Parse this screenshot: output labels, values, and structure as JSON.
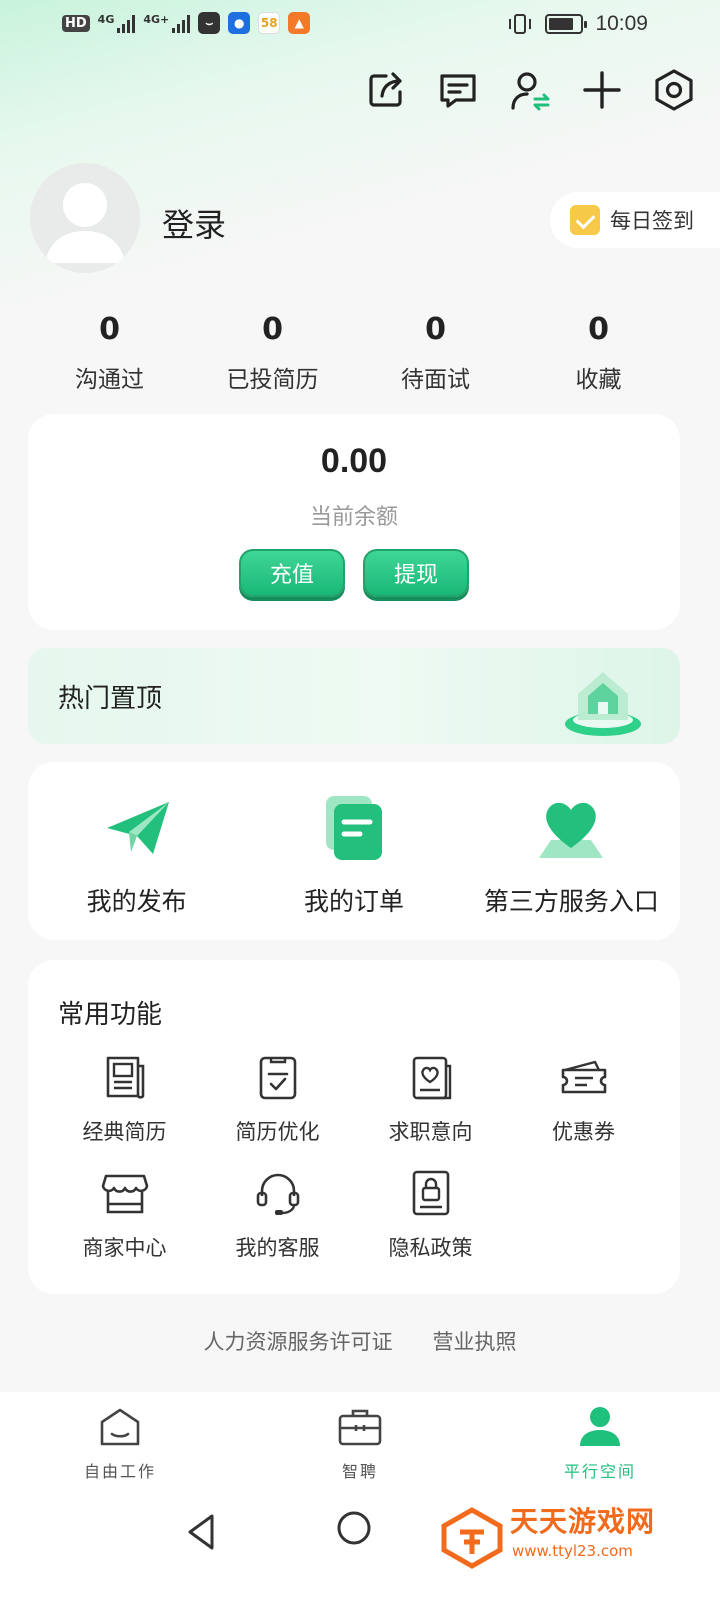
{
  "status_bar": {
    "hd_label": "HD",
    "signal1_label": "4G",
    "signal2_label": "4G+",
    "app_badge_58": "58",
    "time": "10:09"
  },
  "profile": {
    "login_label": "登录",
    "checkin_label": "每日签到"
  },
  "stats": [
    {
      "value": "0",
      "label": "沟通过"
    },
    {
      "value": "0",
      "label": "已投简历"
    },
    {
      "value": "0",
      "label": "待面试"
    },
    {
      "value": "0",
      "label": "收藏"
    }
  ],
  "balance": {
    "amount": "0.00",
    "label": "当前余额",
    "recharge_label": "充值",
    "withdraw_label": "提现"
  },
  "hot": {
    "title": "热门置顶"
  },
  "quick": [
    {
      "label": "我的发布",
      "icon": "paper-plane-icon"
    },
    {
      "label": "我的订单",
      "icon": "order-doc-icon"
    },
    {
      "label": "第三方服务入口",
      "icon": "heart-hand-icon"
    }
  ],
  "common": {
    "title": "常用功能",
    "items": [
      {
        "label": "经典简历",
        "icon": "resume-icon"
      },
      {
        "label": "简历优化",
        "icon": "checklist-icon"
      },
      {
        "label": "求职意向",
        "icon": "heart-doc-icon"
      },
      {
        "label": "优惠券",
        "icon": "coupon-icon"
      },
      {
        "label": "商家中心",
        "icon": "store-icon"
      },
      {
        "label": "我的客服",
        "icon": "headset-icon"
      },
      {
        "label": "隐私政策",
        "icon": "lock-doc-icon"
      }
    ]
  },
  "footer": {
    "license_label": "人力资源服务许可证",
    "business_label": "营业执照"
  },
  "tabs": [
    {
      "label": "自由工作",
      "icon": "home-icon",
      "active": false
    },
    {
      "label": "智聘",
      "icon": "briefcase-icon",
      "active": false
    },
    {
      "label": "平行空间",
      "icon": "person-icon",
      "active": true
    }
  ],
  "watermark": {
    "name": "天天游戏网",
    "url": "www.ttyl23.com"
  },
  "colors": {
    "accent": "#1fbf7c",
    "button_gradient_top": "#3fd697",
    "watermark": "#f26a1b"
  }
}
